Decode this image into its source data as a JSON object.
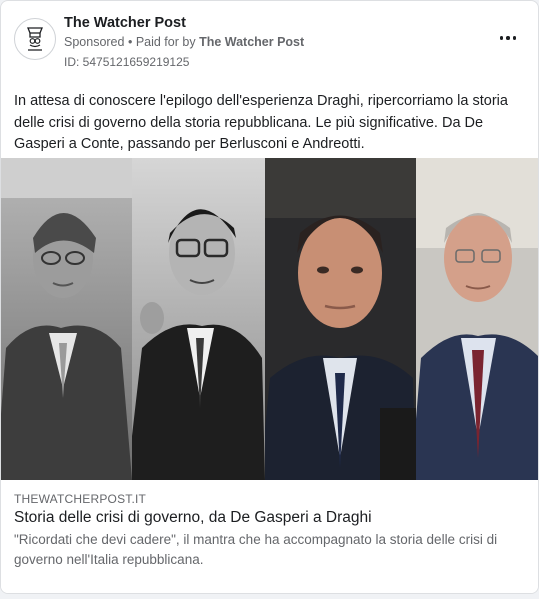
{
  "post": {
    "page_name": "The Watcher Post",
    "sponsored_label": "Sponsored",
    "paid_prefix": "Paid for by",
    "paid_by": "The Watcher Post",
    "ad_id": "ID: 5475121659219125",
    "body": "In attesa di conoscere l'epilogo dell'esperienza Draghi, ripercorriamo la storia delle crisi di governo della storia repubblicana. Le più significative. Da De Gasperi a Conte, passando per Berlusconi e Andreotti."
  },
  "link": {
    "domain": "THEWATCHERPOST.IT",
    "headline": "Storia delle crisi di governo, da De Gasperi a Draghi",
    "description": "\"Ricordati che devi cadere\", il mantra che ha accompagnato la storia delle crisi di governo nell'Italia repubblicana."
  },
  "icons": {
    "avatar": "watcher-post-logo-icon",
    "more": "more-options-icon"
  },
  "colors": {
    "text_primary": "#1c1e21",
    "text_secondary": "#65676b",
    "card_bg": "#ffffff",
    "page_bg": "#f0f2f5"
  }
}
